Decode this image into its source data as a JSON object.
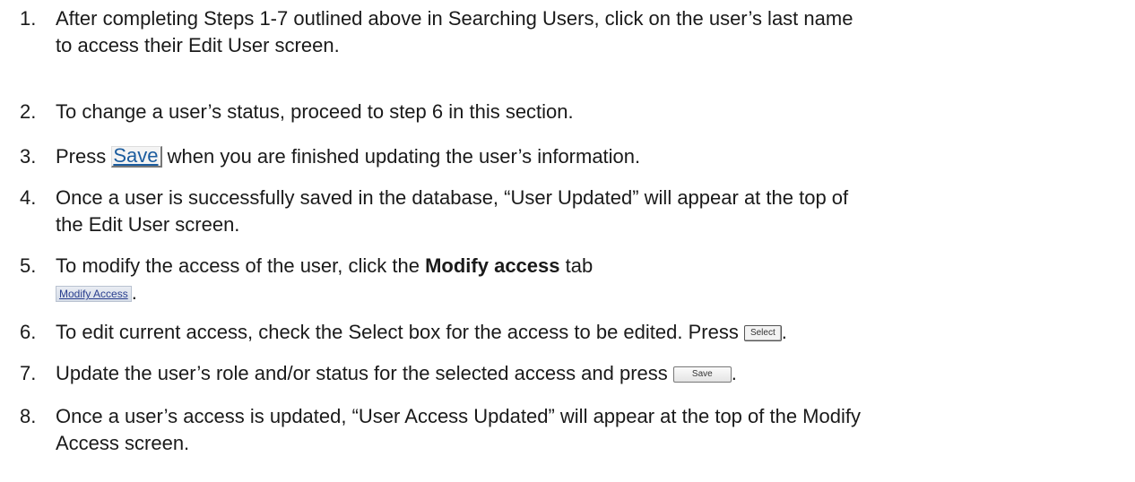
{
  "steps": [
    {
      "number": "1.",
      "line1": "After completing Steps 1-7 outlined above in Searching Users, click on the user’s last name",
      "line2": "to access their Edit User screen."
    },
    {
      "number": "2.",
      "text": "To change a user’s status, proceed to step 6 in this section."
    },
    {
      "number": "3.",
      "before": "Press ",
      "button": "Save",
      "after": " when you are finished updating the user’s information."
    },
    {
      "number": "4.",
      "line1": "Once a user is successfully saved in the database, “User Updated” will appear at the top of",
      "line2": "the Edit User screen."
    },
    {
      "number": "5.",
      "before": "To modify the access of the user, click the ",
      "bold": "Modify access",
      "after": " tab",
      "tab_label": "Modify Access",
      "tail": "."
    },
    {
      "number": "6.",
      "text": "To edit current access, check the Select box for the access to be edited. Press ",
      "button": "Select",
      "tail": "."
    },
    {
      "number": "7.",
      "text": "Update the user’s role and/or status for the selected access and press ",
      "button": "Save",
      "tail": "."
    },
    {
      "number": "8.",
      "line1": "Once a user’s access is updated, “User Access Updated” will appear at the top of the Modify",
      "line2": "Access screen."
    }
  ]
}
